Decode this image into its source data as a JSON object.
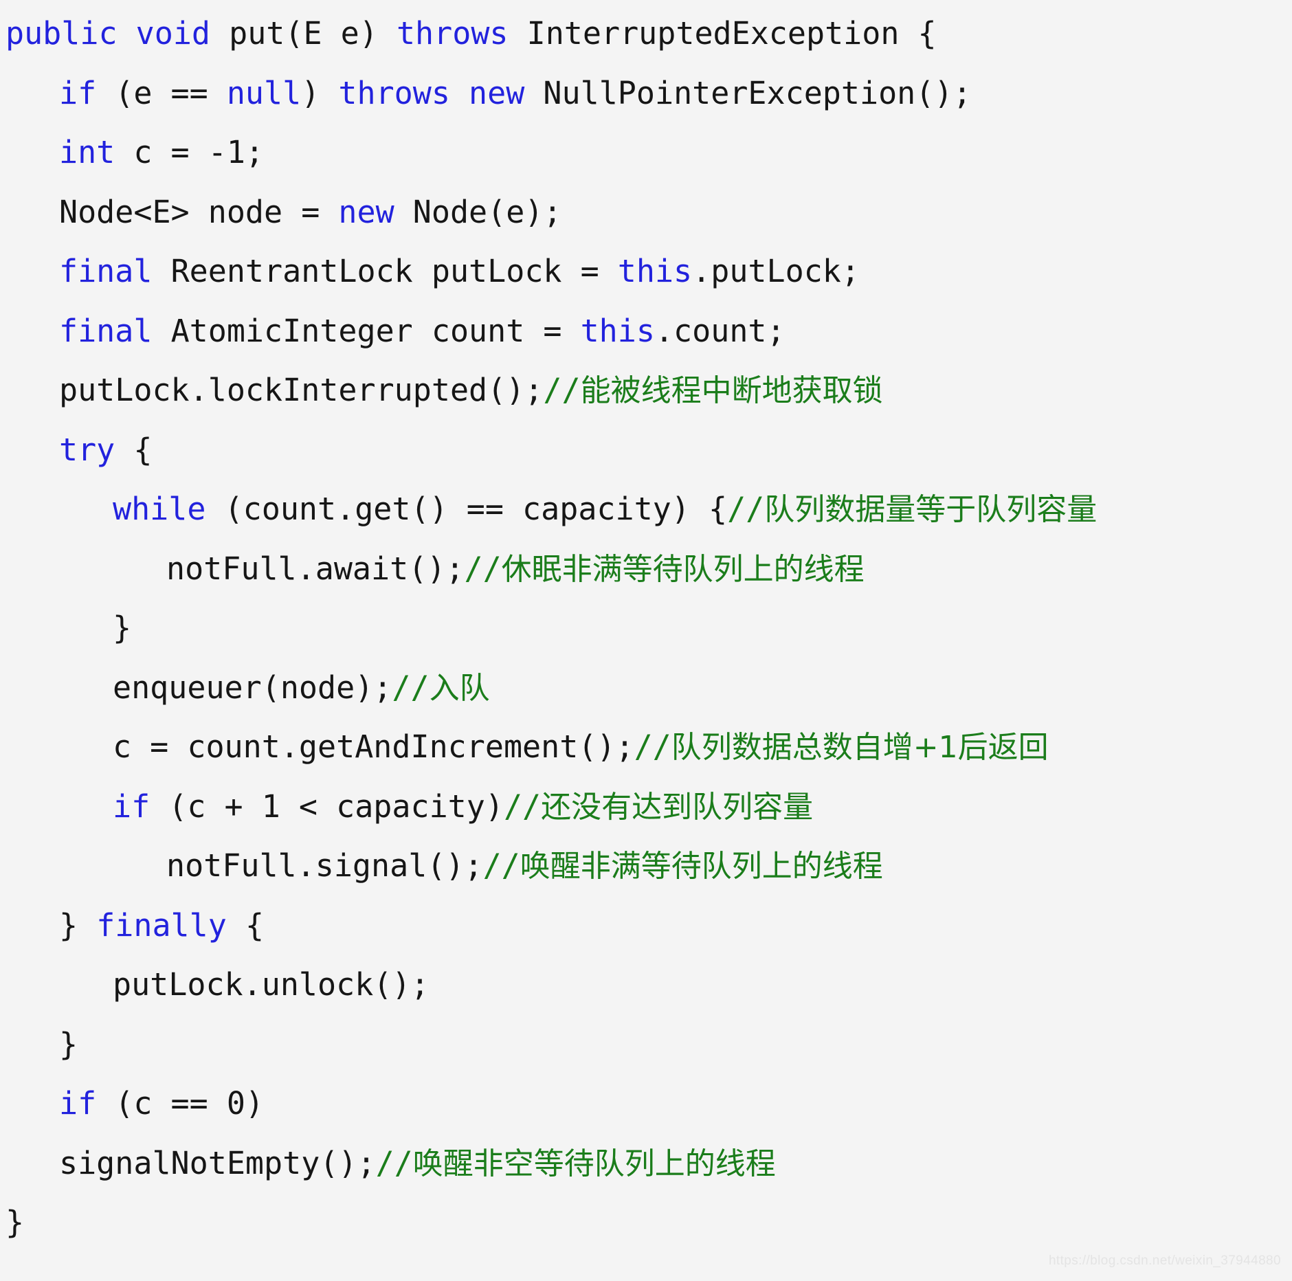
{
  "document": {
    "kind": "source-code-screenshot",
    "language": "Java",
    "background_color": "#f4f4f4",
    "colors": {
      "keyword": "#2222dd",
      "plain": "#161616",
      "comment": "#1b7d1b",
      "watermark": "#e4e4e4"
    },
    "watermark": "https://blog.csdn.net/weixin_37944880"
  },
  "code": {
    "lines": [
      {
        "indent": 0,
        "tokens": [
          {
            "cls": "kw",
            "text": "public void "
          },
          {
            "cls": "plain",
            "text": "put(E e) "
          },
          {
            "cls": "kw",
            "text": "throws "
          },
          {
            "cls": "plain",
            "text": "InterruptedException {"
          }
        ]
      },
      {
        "indent": 1,
        "tokens": [
          {
            "cls": "kw",
            "text": "if "
          },
          {
            "cls": "plain",
            "text": "(e == "
          },
          {
            "cls": "kw",
            "text": "null"
          },
          {
            "cls": "plain",
            "text": ") "
          },
          {
            "cls": "kw",
            "text": "throws new "
          },
          {
            "cls": "plain",
            "text": "NullPointerException();"
          }
        ]
      },
      {
        "indent": 1,
        "tokens": [
          {
            "cls": "kw",
            "text": "int "
          },
          {
            "cls": "plain",
            "text": "c = -1;"
          }
        ]
      },
      {
        "indent": 1,
        "tokens": [
          {
            "cls": "plain",
            "text": "Node<E> node = "
          },
          {
            "cls": "kw",
            "text": "new "
          },
          {
            "cls": "plain",
            "text": "Node(e);"
          }
        ]
      },
      {
        "indent": 1,
        "tokens": [
          {
            "cls": "kw",
            "text": "final "
          },
          {
            "cls": "plain",
            "text": "ReentrantLock putLock = "
          },
          {
            "cls": "kw",
            "text": "this"
          },
          {
            "cls": "plain",
            "text": ".putLock;"
          }
        ]
      },
      {
        "indent": 1,
        "tokens": [
          {
            "cls": "kw",
            "text": "final "
          },
          {
            "cls": "plain",
            "text": "AtomicInteger count = "
          },
          {
            "cls": "kw",
            "text": "this"
          },
          {
            "cls": "plain",
            "text": ".count;"
          }
        ]
      },
      {
        "indent": 1,
        "tokens": [
          {
            "cls": "plain",
            "text": "putLock.lockInterrupted();"
          },
          {
            "cls": "comment",
            "text": "//"
          },
          {
            "cls": "comment cn",
            "text": "能被线程中断地获取锁"
          }
        ]
      },
      {
        "indent": 1,
        "tokens": [
          {
            "cls": "kw",
            "text": "try "
          },
          {
            "cls": "plain",
            "text": "{"
          }
        ]
      },
      {
        "indent": 2,
        "tokens": [
          {
            "cls": "kw",
            "text": "while "
          },
          {
            "cls": "plain",
            "text": "(count.get() == capacity) {"
          },
          {
            "cls": "comment",
            "text": "//"
          },
          {
            "cls": "comment cn",
            "text": "队列数据量等于队列容量"
          }
        ]
      },
      {
        "indent": 3,
        "tokens": [
          {
            "cls": "plain",
            "text": "notFull.await();"
          },
          {
            "cls": "comment",
            "text": "//"
          },
          {
            "cls": "comment cn",
            "text": "休眠非满等待队列上的线程"
          }
        ]
      },
      {
        "indent": 2,
        "tokens": [
          {
            "cls": "plain",
            "text": "}"
          }
        ]
      },
      {
        "indent": 2,
        "tokens": [
          {
            "cls": "plain",
            "text": "enqueuer(node);"
          },
          {
            "cls": "comment",
            "text": "//"
          },
          {
            "cls": "comment cn",
            "text": "入队"
          }
        ]
      },
      {
        "indent": 2,
        "tokens": [
          {
            "cls": "plain",
            "text": "c = count.getAndIncrement();"
          },
          {
            "cls": "comment",
            "text": "//"
          },
          {
            "cls": "comment cn",
            "text": "队列数据总数自增+1后返回"
          }
        ]
      },
      {
        "indent": 2,
        "tokens": [
          {
            "cls": "kw",
            "text": "if "
          },
          {
            "cls": "plain",
            "text": "(c + 1 < capacity)"
          },
          {
            "cls": "comment",
            "text": "//"
          },
          {
            "cls": "comment cn",
            "text": "还没有达到队列容量"
          }
        ]
      },
      {
        "indent": 3,
        "tokens": [
          {
            "cls": "plain",
            "text": "notFull.signal();"
          },
          {
            "cls": "comment",
            "text": "//"
          },
          {
            "cls": "comment cn",
            "text": "唤醒非满等待队列上的线程"
          }
        ]
      },
      {
        "indent": 1,
        "tokens": [
          {
            "cls": "plain",
            "text": "} "
          },
          {
            "cls": "kw",
            "text": "finally "
          },
          {
            "cls": "plain",
            "text": "{"
          }
        ]
      },
      {
        "indent": 2,
        "tokens": [
          {
            "cls": "plain",
            "text": "putLock.unlock();"
          }
        ]
      },
      {
        "indent": 1,
        "tokens": [
          {
            "cls": "plain",
            "text": "}"
          }
        ]
      },
      {
        "indent": 1,
        "tokens": [
          {
            "cls": "kw",
            "text": "if "
          },
          {
            "cls": "plain",
            "text": "(c == 0)"
          }
        ]
      },
      {
        "indent": 1,
        "tokens": [
          {
            "cls": "plain",
            "text": "signalNotEmpty();"
          },
          {
            "cls": "comment",
            "text": "//"
          },
          {
            "cls": "comment cn",
            "text": "唤醒非空等待队列上的线程"
          }
        ]
      },
      {
        "indent": 0,
        "tokens": [
          {
            "cls": "plain",
            "text": "}"
          }
        ]
      }
    ]
  }
}
